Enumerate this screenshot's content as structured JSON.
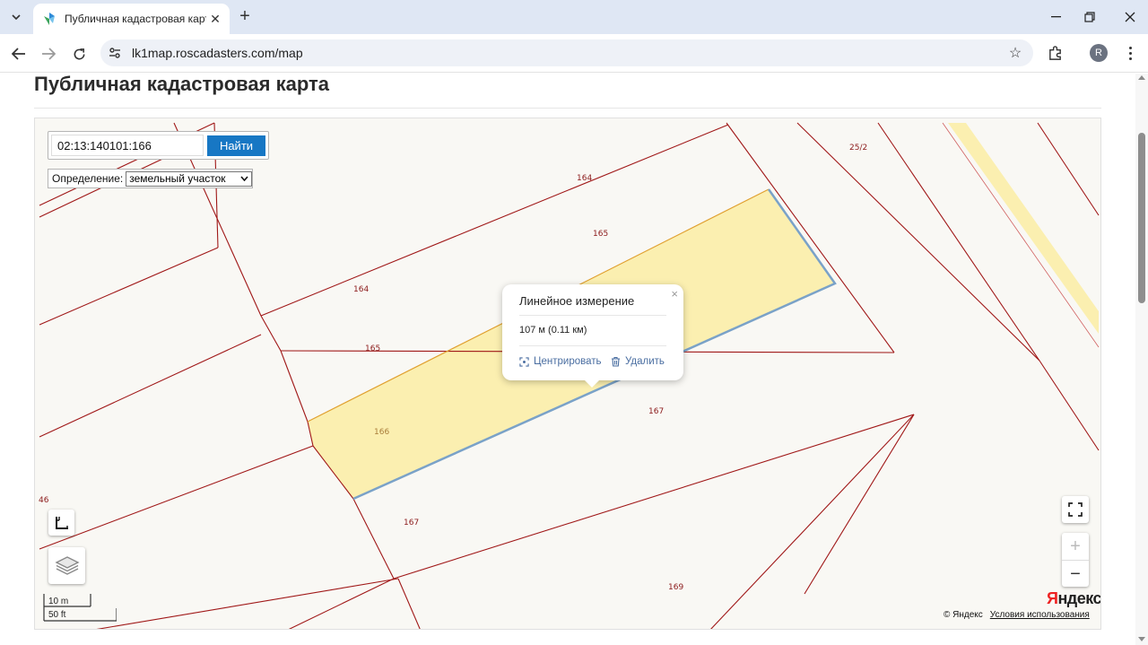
{
  "browser": {
    "tab_title": "Публичная кадастровая карта",
    "url": "lk1map.roscadasters.com/map",
    "profile_initial": "R"
  },
  "page": {
    "title": "Публичная кадастровая карта"
  },
  "search": {
    "query": "02:13:140101:166",
    "button_label": "Найти",
    "definition_label": "Определение:",
    "definition_value": "земельный участок"
  },
  "popup": {
    "title": "Линейное измерение",
    "close": "×",
    "value": "107 м (0.11 км)",
    "center_label": "Центрировать",
    "delete_label": "Удалить"
  },
  "map": {
    "plot_labels": {
      "p164a": "164",
      "p165a": "165",
      "p164b": "164",
      "p165b": "165",
      "p166": "166",
      "p167a": "167",
      "p167b": "167",
      "p169": "169",
      "p25_2": "25/2",
      "p46": "46"
    },
    "scale_m": "10 m",
    "scale_ft": "50 ft",
    "logo": "Яндекс",
    "copyright": "© Яндекс",
    "terms_link": "Условия использования",
    "zoom_in": "+",
    "zoom_out": "−",
    "colors": {
      "parcel_border": "#a01818",
      "selected_fill": "#fbefb0",
      "measure_line": "#7aa2c8",
      "search_button": "#1777c4"
    }
  }
}
